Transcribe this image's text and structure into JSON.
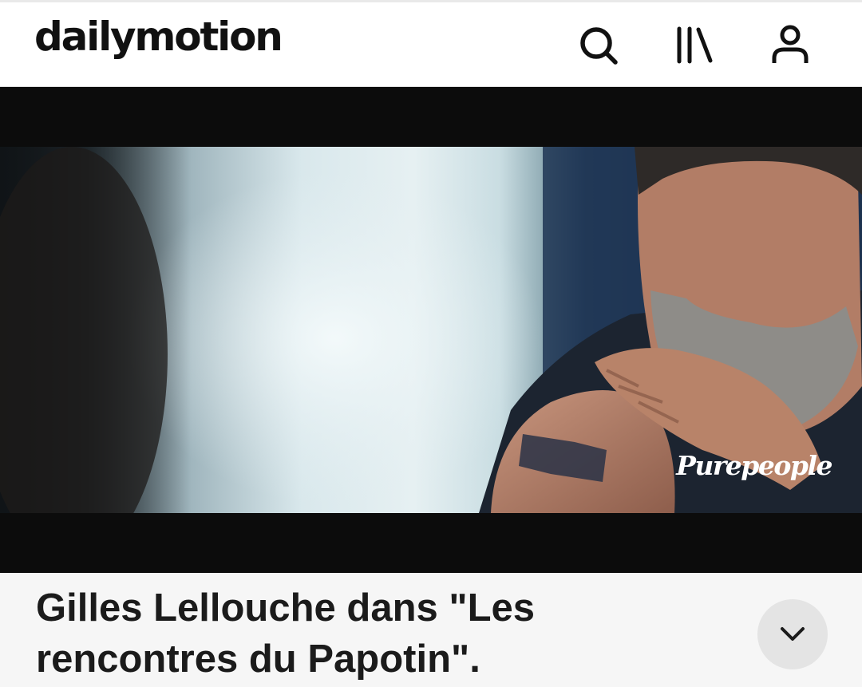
{
  "header": {
    "logo_text": "dailymotion",
    "icons": {
      "search": "search-icon",
      "library": "library-icon",
      "account": "account-icon"
    }
  },
  "player": {
    "watermark": "Purepeople",
    "letterbox_color": "#0c0c0c"
  },
  "video": {
    "title": "Gilles Lellouche dans \"Les rencontres du Papotin\".",
    "expand_icon": "chevron-down-icon"
  },
  "colors": {
    "text_primary": "#1b1b1b",
    "header_bg": "#ffffff",
    "page_bg": "#f6f6f6",
    "button_bg": "#e4e4e4"
  }
}
